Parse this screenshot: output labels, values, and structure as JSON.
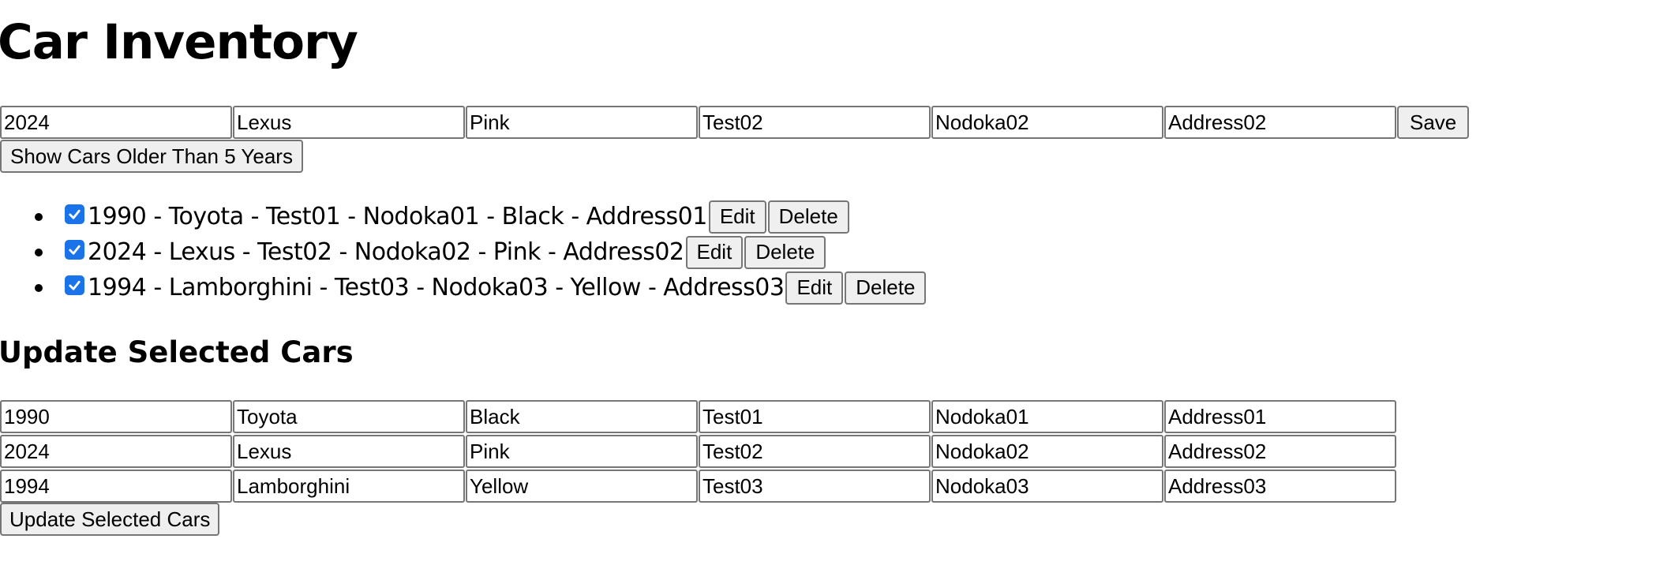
{
  "page": {
    "title": "Car Inventory",
    "section_title": "Update Selected Cars"
  },
  "form": {
    "year": "2024",
    "make": "Lexus",
    "color": "Pink",
    "owner": "Test02",
    "name": "Nodoka02",
    "address": "Address02",
    "save_label": "Save"
  },
  "filter": {
    "older_label": "Show Cars Older Than 5 Years"
  },
  "cars": [
    {
      "text": "1990 - Toyota - Test01 - Nodoka01 - Black - Address01",
      "checked": true,
      "edit_label": "Edit",
      "delete_label": "Delete"
    },
    {
      "text": "2024 - Lexus - Test02 - Nodoka02 - Pink - Address02",
      "checked": true,
      "edit_label": "Edit",
      "delete_label": "Delete"
    },
    {
      "text": "1994 - Lamborghini - Test03 - Nodoka03 - Yellow - Address03",
      "checked": true,
      "edit_label": "Edit",
      "delete_label": "Delete"
    }
  ],
  "update_rows": [
    {
      "year": "1990",
      "make": "Toyota",
      "color": "Black",
      "owner": "Test01",
      "name": "Nodoka01",
      "address": "Address01"
    },
    {
      "year": "2024",
      "make": "Lexus",
      "color": "Pink",
      "owner": "Test02",
      "name": "Nodoka02",
      "address": "Address02"
    },
    {
      "year": "1994",
      "make": "Lamborghini",
      "color": "Yellow",
      "owner": "Test03",
      "name": "Nodoka03",
      "address": "Address03"
    }
  ],
  "update_button_label": "Update Selected Cars",
  "colors": {
    "checkbox_accent": "#1a73e8",
    "button_bg": "#efefef",
    "border": "#767676"
  }
}
